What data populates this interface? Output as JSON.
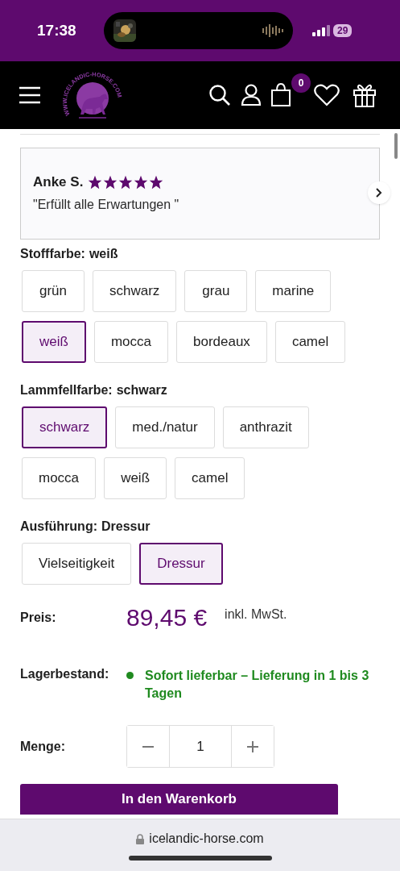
{
  "status_bar": {
    "time": "17:38",
    "battery": "29"
  },
  "header": {
    "logo_text": "WWW.ICELANDIC-HORSE.COM",
    "cart_count": "0"
  },
  "review": {
    "author": "Anke S.",
    "stars": 5,
    "text": "\"Erfüllt alle Erwartungen \""
  },
  "options": [
    {
      "label": "Stofffarbe:",
      "value": "weiß",
      "choices": [
        {
          "label": "grün",
          "selected": false
        },
        {
          "label": "schwarz",
          "selected": false
        },
        {
          "label": "grau",
          "selected": false
        },
        {
          "label": "marine",
          "selected": false
        },
        {
          "label": "weiß",
          "selected": true
        },
        {
          "label": "mocca",
          "selected": false
        },
        {
          "label": "bordeaux",
          "selected": false
        },
        {
          "label": "camel",
          "selected": false
        }
      ]
    },
    {
      "label": "Lammfellfarbe:",
      "value": "schwarz",
      "choices": [
        {
          "label": "schwarz",
          "selected": true
        },
        {
          "label": "med./natur",
          "selected": false
        },
        {
          "label": "anthrazit",
          "selected": false
        },
        {
          "label": "mocca",
          "selected": false
        },
        {
          "label": "weiß",
          "selected": false
        },
        {
          "label": "camel",
          "selected": false
        }
      ]
    },
    {
      "label": "Ausführung:",
      "value": "Dressur",
      "choices": [
        {
          "label": "Vielseitigkeit",
          "selected": false
        },
        {
          "label": "Dressur",
          "selected": true
        }
      ]
    }
  ],
  "price": {
    "label": "Preis:",
    "amount": "89,45 €",
    "tax_note": "inkl. MwSt."
  },
  "stock": {
    "label": "Lagerbestand:",
    "available": true,
    "text": "Sofort lieferbar – Lieferung in 1 bis 3 Tagen"
  },
  "quantity": {
    "label": "Menge:",
    "value": "1"
  },
  "cart_button": {
    "label": "In den Warenkorb"
  },
  "browser_bar": {
    "url": "icelandic-horse.com"
  }
}
